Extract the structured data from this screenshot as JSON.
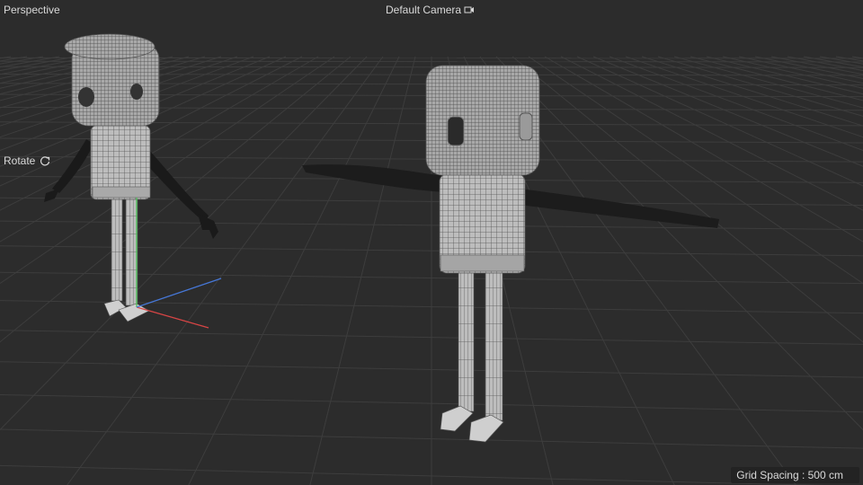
{
  "viewport": {
    "view_mode": "Perspective",
    "camera": "Default Camera",
    "camera_icon": "camera-icon",
    "nav_mode": "Rotate",
    "nav_icon": "rotate-icon",
    "grid_spacing": "Grid Spacing : 500 cm"
  },
  "colors": {
    "background": "#2c2c2c",
    "grid_line": "#3d3d3d",
    "mesh_fill": "#b9b9b9",
    "wire": "#4a4a4a",
    "axis_x": "#d64545",
    "axis_y": "#3fbf4a",
    "axis_z": "#4677d6"
  }
}
